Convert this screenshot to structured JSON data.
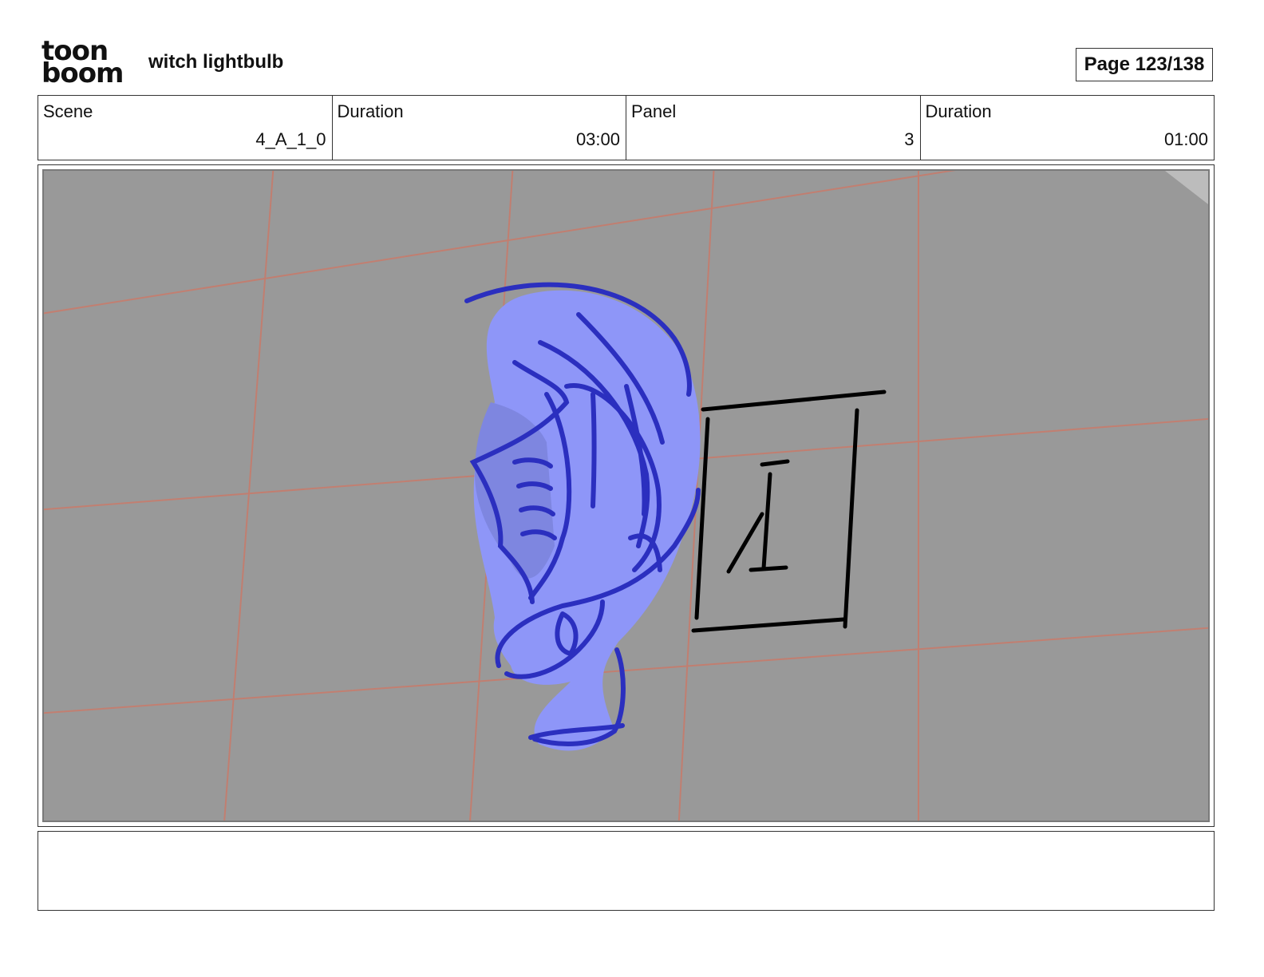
{
  "header": {
    "logo_line1": "toon",
    "logo_line2": "boom",
    "title": "witch lightbulb",
    "page": "Page 123/138"
  },
  "info": {
    "scene_label": "Scene",
    "scene_value": "4_A_1_0",
    "scene_duration_label": "Duration",
    "scene_duration_value": "03:00",
    "panel_label": "Panel",
    "panel_value": "3",
    "panel_duration_label": "Duration",
    "panel_duration_value": "01:00"
  },
  "notes": {
    "text": ""
  },
  "colors": {
    "canvas": "#999999",
    "grid_line": "#c97a6a",
    "ear_fill": "#8e96f8",
    "ear_stroke": "#2b2fbf",
    "sketch_stroke": "#000000"
  }
}
